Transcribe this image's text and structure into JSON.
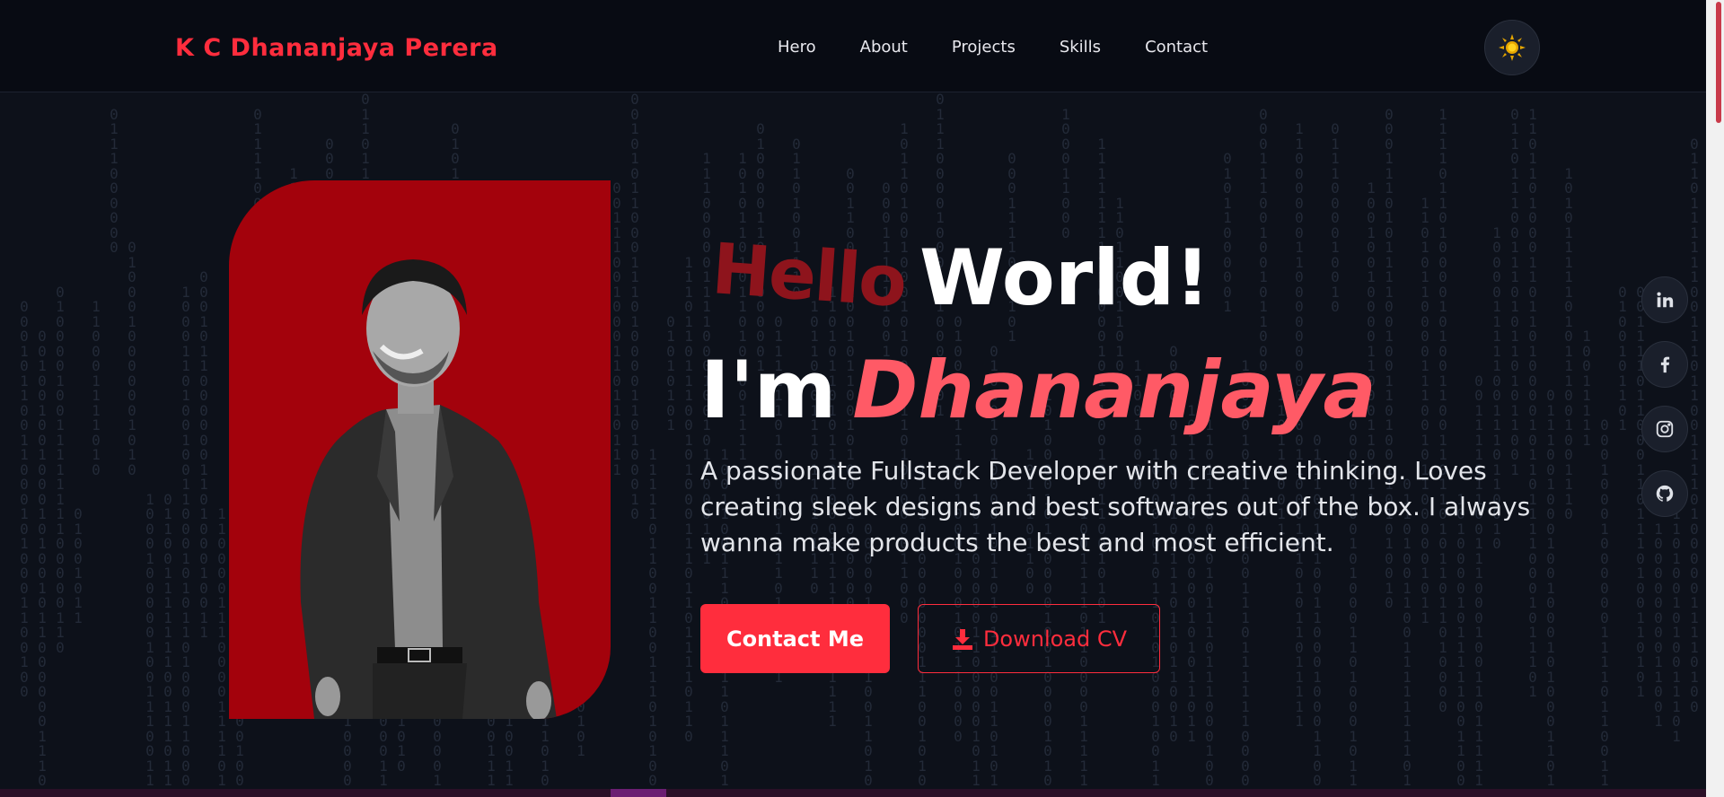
{
  "brand": "K C Dhananjaya Perera",
  "nav": {
    "links": [
      "Hero",
      "About",
      "Projects",
      "Skills",
      "Contact"
    ]
  },
  "theme_toggle": {
    "icon": "sun-icon"
  },
  "hero": {
    "hello": "Hello",
    "world": "World!",
    "im": "I'm",
    "name": "Dhananjaya",
    "tagline": "A passionate Fullstack Developer with creative thinking. Loves creating sleek designs and best softwares out of the box. I always wanna make products the best and most efficient.",
    "contact_button": "Contact Me",
    "download_button": "Download CV"
  },
  "social": [
    "linkedin-icon",
    "facebook-icon",
    "instagram-icon",
    "github-icon"
  ],
  "colors": {
    "accent": "#ff2d3d",
    "name": "#ff5a66",
    "card": "#a3020c",
    "background": "#0d111a"
  }
}
